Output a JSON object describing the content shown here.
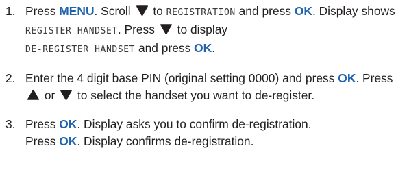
{
  "colors": {
    "keyword": "#1f63ad",
    "text": "#231f20",
    "lcd": "#3a3a3a"
  },
  "icons": {
    "down": "down-arrow-key-icon",
    "up": "up-arrow-key-icon"
  },
  "steps": [
    {
      "num": "1.",
      "press": "Press ",
      "menu": "MENU",
      "scroll": ". Scroll ",
      "to": " to ",
      "lcd_registration": "REGISTRATION",
      "and_press": " and press ",
      "ok": "OK",
      "display_shows": ". Display shows ",
      "lcd_register": "REGISTER HANDSET",
      "press2": ". Press ",
      "to_display": " to display",
      "lcd_deregister": "DE-REGISTER HANDSET",
      "and_press2": " and press ",
      "ok2": "OK",
      "end": "."
    },
    {
      "num": "2.",
      "enter": "Enter the 4 digit base PIN (original setting 0000) and press ",
      "ok": "OK",
      "press": ". Press ",
      "or": " or ",
      "select": " to select the handset you want to de-register."
    },
    {
      "num": "3.",
      "press": "Press ",
      "ok": "OK",
      "asks": ". Display asks you to confirm de-registration.",
      "press2": "Press ",
      "ok2": "OK",
      "confirms": ". Display confirms de-registration."
    }
  ]
}
